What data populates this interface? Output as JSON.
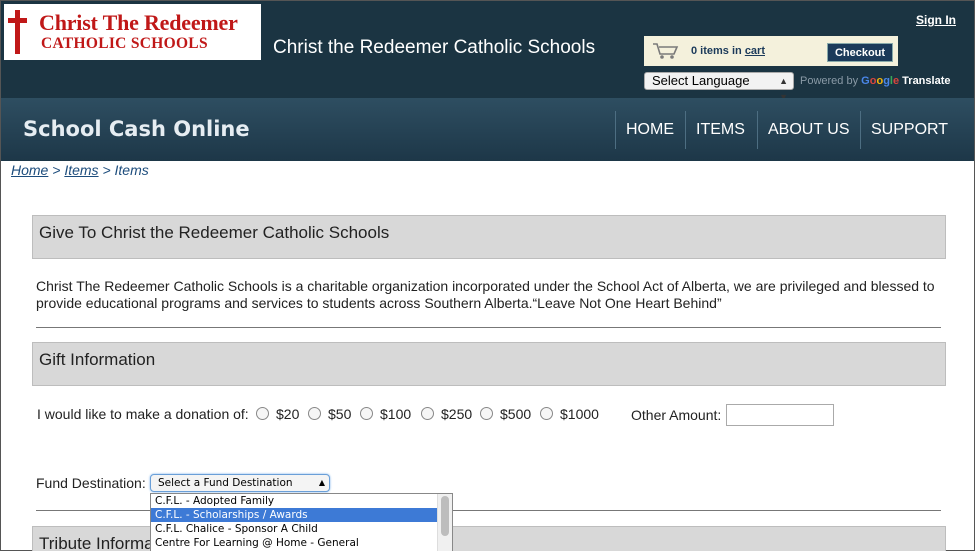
{
  "header": {
    "logo_line1": "Christ The Redeemer",
    "logo_line2": "CATHOLIC SCHOOLS",
    "site_title": "Christ the Redeemer Catholic Schools",
    "signin": "Sign In",
    "cart": {
      "count_text": "0 items in",
      "cart_link": "cart",
      "checkout": "Checkout"
    },
    "language_select": "Select Language",
    "powered_by": "Powered by",
    "google": "Google",
    "translate": "Translate"
  },
  "nav": {
    "app_name": "School Cash Online",
    "items": [
      "HOME",
      "ITEMS",
      "ABOUT US",
      "SUPPORT"
    ]
  },
  "breadcrumb": {
    "home": "Home",
    "sep": ">",
    "items": "Items",
    "current": "Items"
  },
  "give_section": {
    "title": "Give To Christ the Redeemer Catholic Schools",
    "description": "Christ The Redeemer Catholic Schools is a charitable organization incorporated under the School Act of Alberta, we are privileged and blessed to provide educational programs and services to students across Southern Alberta.“Leave Not One Heart Behind”"
  },
  "gift_section": {
    "title": "Gift Information",
    "donation_label": "I would like to make a donation of:",
    "amounts": [
      "$20",
      "$50",
      "$100",
      "$250",
      "$500",
      "$1000"
    ],
    "other_label": "Other Amount:",
    "other_value": "",
    "fund_label": "Fund Destination:",
    "fund_selected": "Select a Fund Destination",
    "fund_options": [
      "C.F.L. - Adopted Family",
      "C.F.L. - Scholarships / Awards",
      "C.F.L. Chalice - Sponsor A Child",
      "Centre For Learning @ Home - General"
    ],
    "fund_highlighted_index": 1
  },
  "tribute_section": {
    "title": "Tribute Information"
  },
  "colors": {
    "header_bg": "#1b3442",
    "brand_red": "#c01818",
    "highlight": "#3d7ad6"
  }
}
